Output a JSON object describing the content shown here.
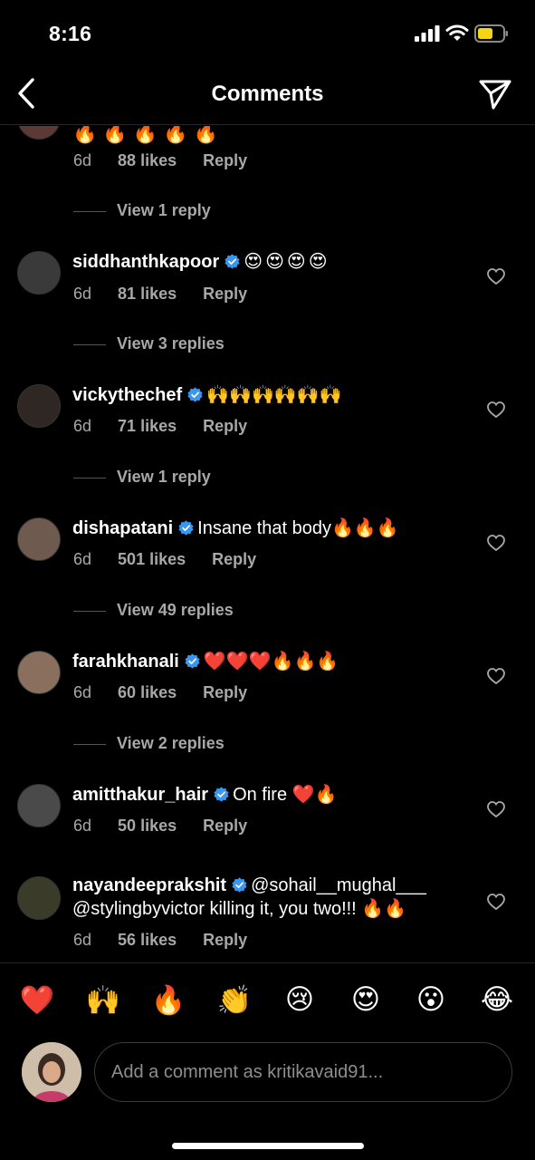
{
  "status_bar": {
    "time": "8:16"
  },
  "header": {
    "title": "Comments"
  },
  "partial_comment": {
    "text": "🔥🔥🔥🔥🔥",
    "age": "6d",
    "likes": "88 likes",
    "reply": "Reply",
    "view_replies": "View 1 reply"
  },
  "comments": [
    {
      "username": "siddhanthkapoor",
      "verified": true,
      "text": "😍😍😍😍",
      "age": "6d",
      "likes": "81 likes",
      "reply": "Reply",
      "view_replies": "View 3 replies"
    },
    {
      "username": "vickythechef",
      "verified": true,
      "text": "🙌🙌🙌🙌🙌🙌",
      "age": "6d",
      "likes": "71 likes",
      "reply": "Reply",
      "view_replies": "View 1 reply"
    },
    {
      "username": "dishapatani",
      "verified": true,
      "text": "Insane that body🔥🔥🔥",
      "age": "6d",
      "likes": "501 likes",
      "reply": "Reply",
      "view_replies": "View 49 replies"
    },
    {
      "username": "farahkhanali",
      "verified": true,
      "text": "❤️❤️❤️🔥🔥🔥",
      "age": "6d",
      "likes": "60 likes",
      "reply": "Reply",
      "view_replies": "View 2 replies"
    },
    {
      "username": "amitthakur_hair",
      "verified": true,
      "text": "On fire ❤️🔥",
      "age": "6d",
      "likes": "50 likes",
      "reply": "Reply"
    },
    {
      "username": "nayandeeprakshit",
      "verified": true,
      "text": "@sohail__mughal___ @stylingbyvictor killing it, you two!!! 🔥🔥",
      "age": "6d",
      "likes": "56 likes",
      "reply": "Reply"
    }
  ],
  "reactions": [
    "❤️",
    "🙌",
    "🔥",
    "👏",
    "😢",
    "😍",
    "😮",
    "😂"
  ],
  "composer": {
    "placeholder": "Add a comment as kritikavaid91..."
  },
  "colors": {
    "background": "#000000",
    "muted_text": "#a8a8a8",
    "verified_blue": "#3897f0",
    "battery": "#f7d413"
  }
}
